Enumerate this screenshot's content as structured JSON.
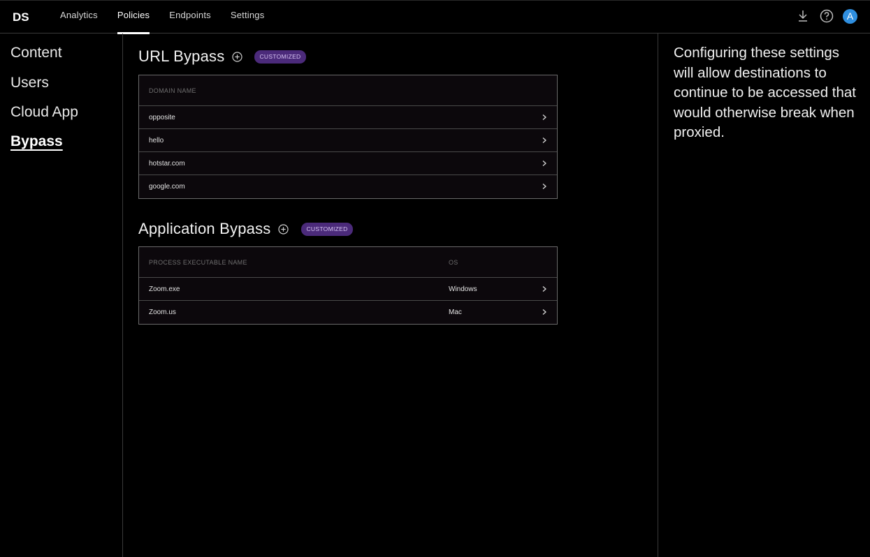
{
  "app": {
    "logo_text": "DS",
    "nav": [
      {
        "label": "Analytics",
        "active": false
      },
      {
        "label": "Policies",
        "active": true
      },
      {
        "label": "Endpoints",
        "active": false
      },
      {
        "label": "Settings",
        "active": false
      }
    ],
    "icons": [
      "download-icon",
      "help-icon"
    ],
    "avatar_initial": "A",
    "avatar_color": "#2f8fe0"
  },
  "sidebar": {
    "items": [
      {
        "label": "Content"
      },
      {
        "label": "Users"
      },
      {
        "label": "Cloud App"
      },
      {
        "label": "Bypass",
        "active": true
      }
    ]
  },
  "url_bypass": {
    "title": "URL Bypass",
    "badge": "CUSTOMIZED",
    "columns": [
      "DOMAIN NAME"
    ],
    "rows": [
      {
        "domain": "opposite"
      },
      {
        "domain": "hello"
      },
      {
        "domain": "hotstar.com"
      },
      {
        "domain": "google.com"
      }
    ]
  },
  "app_bypass": {
    "title": "Application Bypass",
    "badge": "CUSTOMIZED",
    "columns": [
      "PROCESS EXECUTABLE NAME",
      "OS"
    ],
    "rows": [
      {
        "process": "Zoom.exe",
        "os": "Windows"
      },
      {
        "process": "Zoom.us",
        "os": "Mac"
      }
    ]
  },
  "help": {
    "text": "Configuring these settings will allow destinations to continue to be accessed that would otherwise break when proxied."
  },
  "colors": {
    "badge_bg": "#4b2a7a",
    "badge_text": "#d7c4f3",
    "avatar": "#2f8fe0"
  }
}
